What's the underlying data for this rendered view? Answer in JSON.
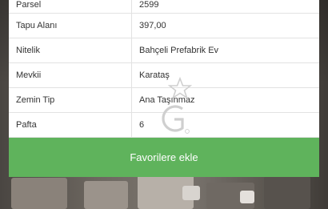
{
  "details": {
    "rows": [
      {
        "label": "Parsel",
        "value": "2599"
      },
      {
        "label": "Tapu Alanı",
        "value": "397,00"
      },
      {
        "label": "Nitelik",
        "value": "Bahçeli Prefabrik Ev"
      },
      {
        "label": "Mevkii",
        "value": "Karataş"
      },
      {
        "label": "Zemin Tip",
        "value": "Ana Taşınmaz"
      },
      {
        "label": "Pafta",
        "value": "6"
      }
    ]
  },
  "actions": {
    "favorite_label": "Favorilere ekle"
  },
  "colors": {
    "accent_green": "#5fb35c"
  },
  "watermark": {
    "icon": "star-g-logo-icon"
  }
}
